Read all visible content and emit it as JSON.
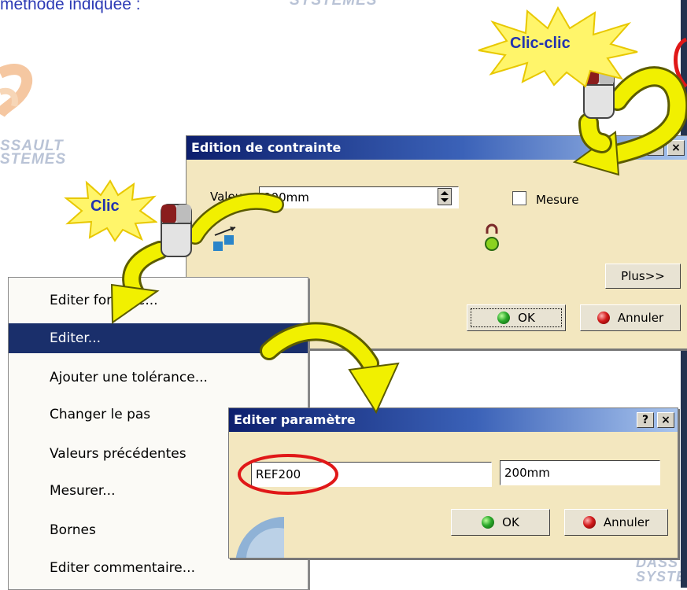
{
  "slide": {
    "intro_text": "méthode indiquée :",
    "watermark_top": "SYSTEMES",
    "watermark_left_1": "SSAULT",
    "watermark_left_2": "STEMES",
    "watermark_bottom_1": "DASS",
    "watermark_bottom_2": "SYSTE",
    "callout_double_click": "Clic-clic",
    "callout_click": "Clic"
  },
  "constraint_dialog": {
    "title": "Edition de contrainte",
    "help_label": "?",
    "close_label": "×",
    "value_label": "Valeur",
    "value": "200mm",
    "measure_label": "Mesure",
    "measure_checked": false,
    "more_label": "Plus>>",
    "ok_label": "OK",
    "cancel_label": "Annuler"
  },
  "context_menu": {
    "items": [
      {
        "label": "Editer formule..."
      },
      {
        "label": "Editer..."
      },
      {
        "label": "Ajouter une tolérance..."
      },
      {
        "label": "Changer le pas"
      },
      {
        "label": "Valeurs précédentes"
      },
      {
        "label": "Mesurer..."
      },
      {
        "label": "Bornes"
      },
      {
        "label": "Editer commentaire..."
      }
    ],
    "selected_index": 1
  },
  "parameter_dialog": {
    "title": "Editer paramètre",
    "help_label": "?",
    "close_label": "×",
    "name": "REF200",
    "value": "200mm",
    "ok_label": "OK",
    "cancel_label": "Annuler"
  },
  "colors": {
    "highlight_red": "#e01818",
    "arrow_yellow": "#f1f000",
    "menu_selection": "#1a2f6b"
  }
}
